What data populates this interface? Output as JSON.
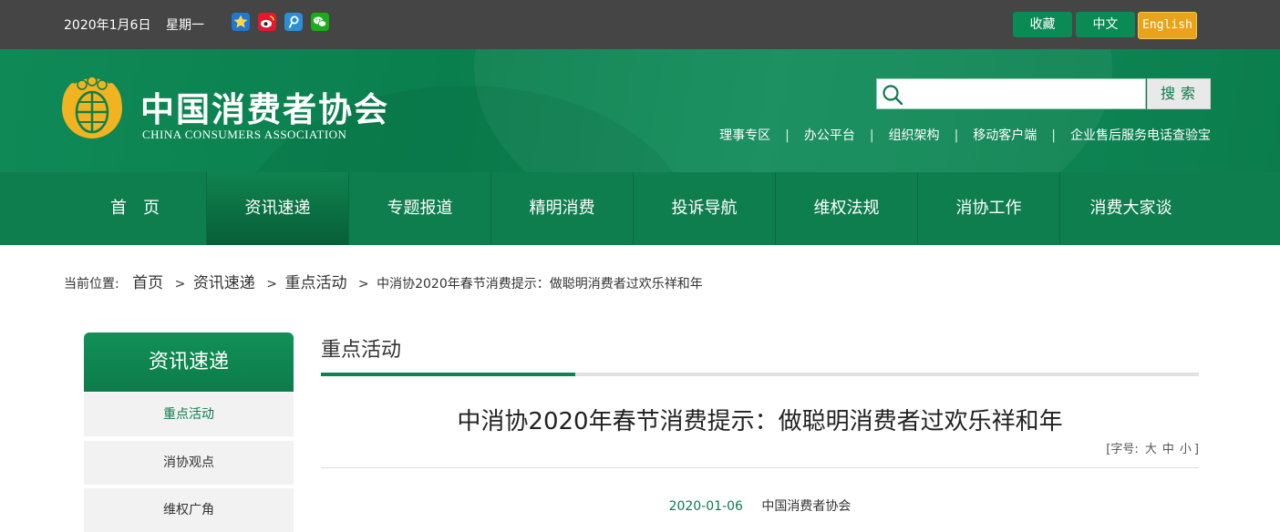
{
  "topbar": {
    "date": "2020年1月6日",
    "weekday": "星期一",
    "social": [
      {
        "icon": "qzone-icon",
        "color": "#1f78d1"
      },
      {
        "icon": "weibo-icon",
        "color": "#e6162d"
      },
      {
        "icon": "tencent-weibo-icon",
        "color": "#2b8fd6"
      },
      {
        "icon": "wechat-icon",
        "color": "#1aad19"
      }
    ],
    "buttons": {
      "favorite": "收藏",
      "chinese": "中文",
      "english": "English"
    }
  },
  "header": {
    "logo_cn": "中国消费者协会",
    "logo_en": "CHINA CONSUMERS ASSOCIATION",
    "search_placeholder": "",
    "search_button": "搜索",
    "links": [
      "理事专区",
      "办公平台",
      "组织架构",
      "移动客户端",
      "企业售后服务电话查验宝"
    ],
    "link_separator": "|"
  },
  "nav": {
    "items": [
      "首　页",
      "资讯速递",
      "专题报道",
      "精明消费",
      "投诉导航",
      "维权法规",
      "消协工作",
      "消费大家谈"
    ],
    "active_index": 1
  },
  "breadcrumb": {
    "label": "当前位置:",
    "items": [
      "首页",
      "资讯速递",
      "重点活动"
    ],
    "current": "中消协2020年春节消费提示：做聪明消费者过欢乐祥和年",
    "arrow": ">"
  },
  "sidebar": {
    "title": "资讯速递",
    "items": [
      "重点活动",
      "消协观点",
      "维权广角"
    ],
    "active_index": 0
  },
  "main": {
    "section_title": "重点活动",
    "article_title": "中消协2020年春节消费提示：做聪明消费者过欢乐祥和年",
    "font_size": {
      "prefix": "[字号:",
      "large": "大",
      "medium": "中",
      "small": "小",
      "suffix": "]"
    },
    "date": "2020-01-06",
    "source": "中国消费者协会"
  },
  "colors": {
    "brand_green": "#0f7e4f",
    "accent_orange": "#e9a31b",
    "topbar_bg": "#454545"
  }
}
